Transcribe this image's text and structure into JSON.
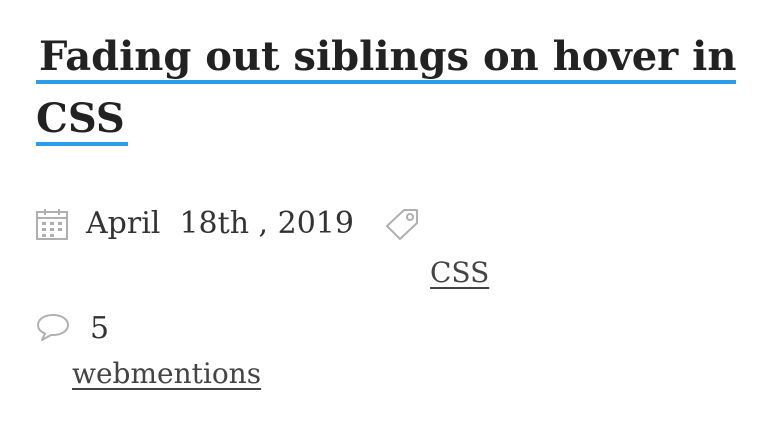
{
  "post": {
    "title": "Fading out siblings on hover in CSS",
    "date": "April  18th , 2019",
    "tag": "CSS",
    "webmention_count": "5",
    "webmention_label": "webmentions"
  },
  "icons": {
    "date": "calendar-icon",
    "tag": "tag-icon",
    "comments": "speech-bubble-icon"
  },
  "colors": {
    "title_underline": "#2a9ee8",
    "icon": "#b0b0b0",
    "text": "#333333"
  }
}
